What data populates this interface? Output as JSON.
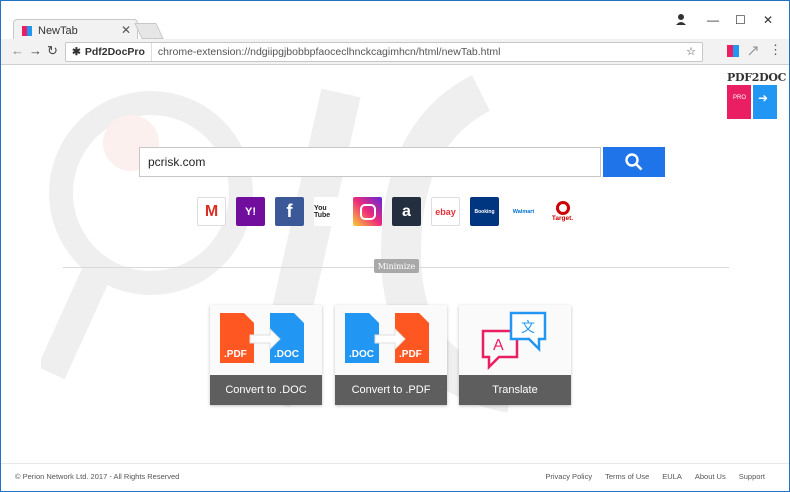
{
  "browser": {
    "tab_title": "NewTab",
    "extension_label": "Pdf2DocPro",
    "url": "chrome-extension://ndgiipgjbobbpfaoceclhnckcagimhcn/html/newTab.html"
  },
  "logo": {
    "text": "PDF2DOC",
    "badge": "PRO"
  },
  "search": {
    "value": "pcrisk.com"
  },
  "quick_links": [
    {
      "name": "Gmail",
      "label": "M",
      "color": "#ffffff"
    },
    {
      "name": "Yahoo",
      "label": "Y!",
      "color": "#5f01d1"
    },
    {
      "name": "Facebook",
      "label": "f",
      "color": "#3b5998"
    },
    {
      "name": "YouTube",
      "label": "You Tube",
      "color": "#ffffff"
    },
    {
      "name": "Instagram",
      "label": "",
      "color": "#d6249f"
    },
    {
      "name": "Amazon",
      "label": "a",
      "color": "#232f3e"
    },
    {
      "name": "eBay",
      "label": "ebay",
      "color": "#ffffff"
    },
    {
      "name": "Booking",
      "label": "Booking",
      "color": "#003580"
    },
    {
      "name": "Walmart",
      "label": "Walmart",
      "color": "#ffffff"
    },
    {
      "name": "Target",
      "label": "Target.",
      "color": "#ffffff"
    }
  ],
  "minimize_label": "Minimize",
  "tiles": [
    {
      "label": "Convert to .DOC",
      "from": ".PDF",
      "to": ".DOC"
    },
    {
      "label": "Convert to .PDF",
      "from": ".DOC",
      "to": ".PDF"
    },
    {
      "label": "Translate",
      "from": "A",
      "to": "文"
    }
  ],
  "footer": {
    "copyright": "© Perion Network Ltd. 2017 - All Rights Reserved",
    "links": [
      "Privacy Policy",
      "Terms of Use",
      "EULA",
      "About Us",
      "Support"
    ]
  },
  "colors": {
    "accent": "#1e74e8",
    "pdf": "#ff5722",
    "doc": "#2196f3",
    "tile_label": "#5e5e5e"
  }
}
